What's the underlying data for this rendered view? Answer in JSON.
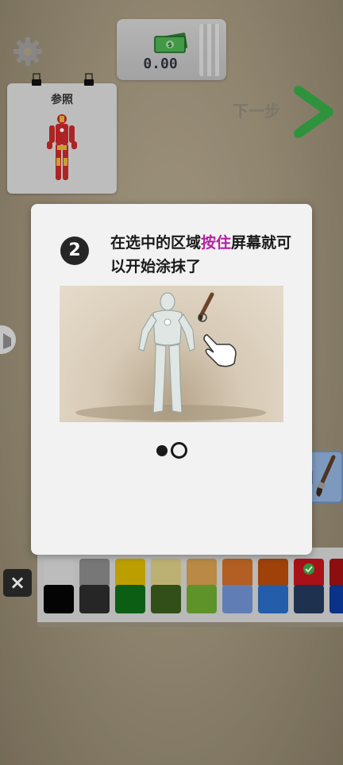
{
  "hud": {
    "money_value": "0.00",
    "next_label": "下一步",
    "reference_title": "参照"
  },
  "dialog": {
    "step_number": "2",
    "instruction_part1": "在选中的区域",
    "instruction_highlight": "按住",
    "instruction_part2": "屏幕就可以开始涂抹了",
    "page_count": 2,
    "current_page": 2
  },
  "palette": {
    "close_label": "×",
    "selected_color": "#c0141c",
    "row1": [
      "#d6d6d6",
      "#888888",
      "#d8b400",
      "#d7c982",
      "#d39c4f",
      "#cc6c27",
      "#b64b0b",
      "#c0141c",
      "#a01010"
    ],
    "row2": [
      "#050505",
      "#2c2c2c",
      "#0f6b19",
      "#3b5b1d",
      "#6aa82e",
      "#6f8fce",
      "#2a6ac2",
      "#23395c",
      "#0d3a9c"
    ]
  },
  "colors": {
    "highlight": "#b321a4",
    "next_arrow": "#35a845"
  }
}
